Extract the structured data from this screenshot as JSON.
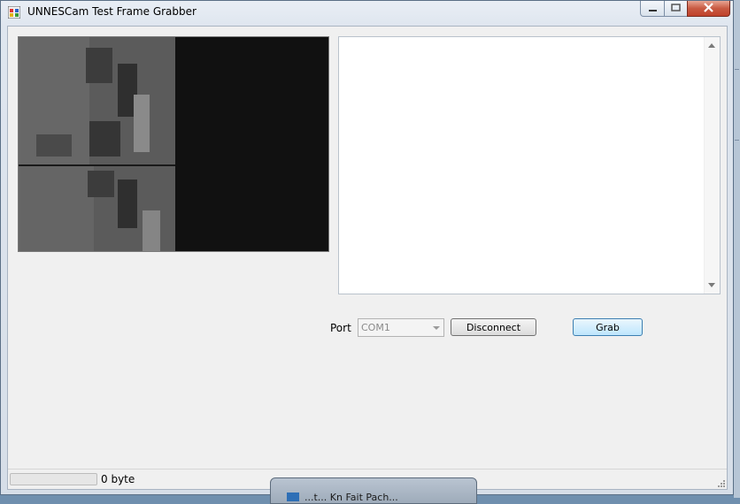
{
  "window": {
    "title": "UNNESCam Test Frame Grabber"
  },
  "controls": {
    "port_label": "Port",
    "port_value": "COM1",
    "disconnect_label": "Disconnect",
    "grab_label": "Grab"
  },
  "log": {
    "text": ""
  },
  "status": {
    "progress_fraction": 0,
    "text": "0 byte"
  },
  "popup": {
    "label": "...t... Kn Fait Pach..."
  },
  "colors": {
    "progress_fill": "#06b025",
    "close_button": "#c85a42",
    "video_background": "#111111"
  },
  "icons": {
    "app": "app-window-icon",
    "minimize": "minimize-icon",
    "maximize": "maximize-icon",
    "close": "close-icon",
    "scroll_up": "chevron-up-icon",
    "scroll_down": "chevron-down-icon",
    "dropdown": "chevron-down-icon",
    "resize_grip": "resize-grip-icon"
  }
}
